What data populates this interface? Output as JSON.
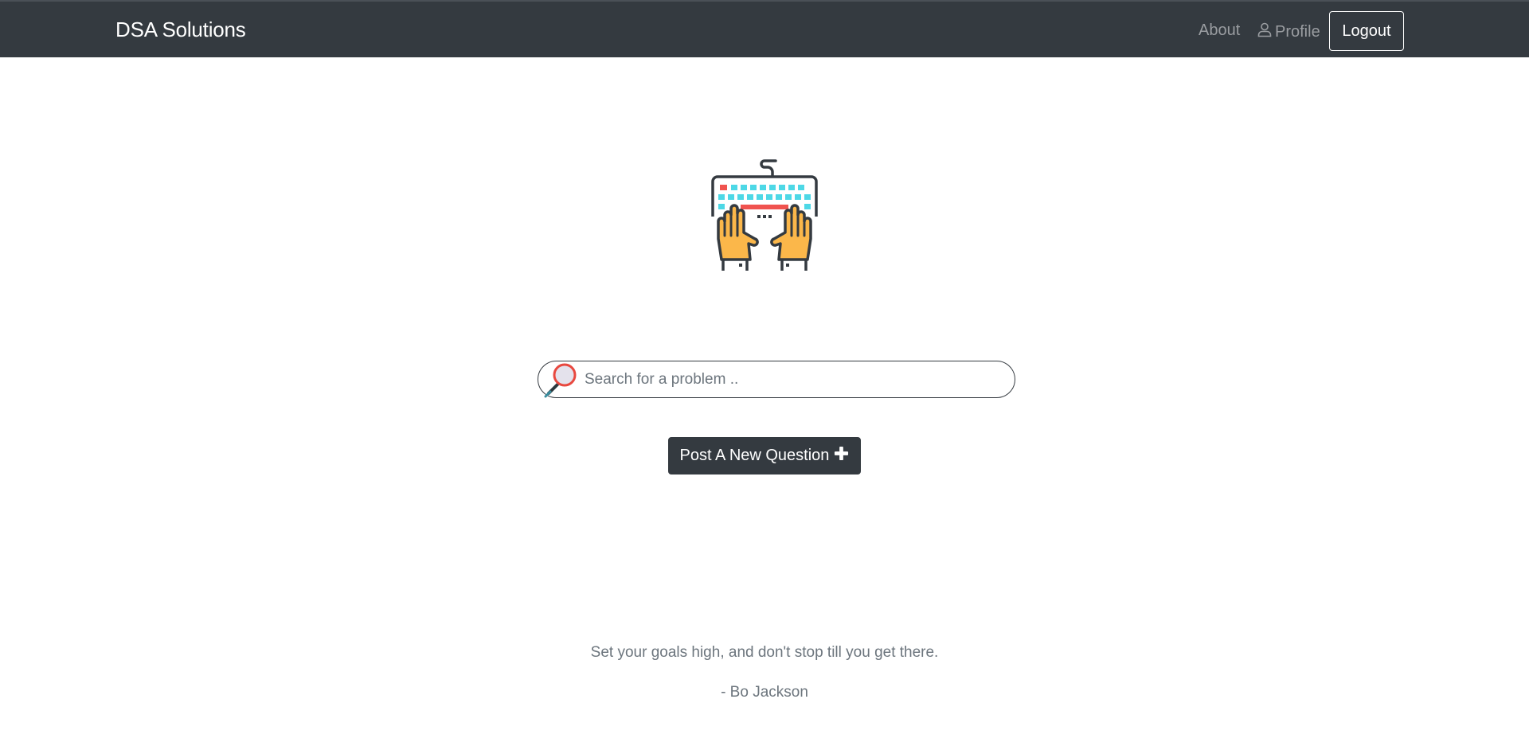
{
  "navbar": {
    "brand": "DSA Solutions",
    "about_label": "About",
    "profile_label": "Profile",
    "logout_label": "Logout"
  },
  "hero": {
    "illustration": "keyboard-hands-icon"
  },
  "search": {
    "icon": "search-icon",
    "placeholder": "Search for a problem ..",
    "value": ""
  },
  "actions": {
    "post_label": "Post A New Question",
    "post_icon": "plus-icon"
  },
  "quote": {
    "text": "Set your goals high, and don't stop till you get there.",
    "author": "- Bo Jackson"
  },
  "colors": {
    "navbar_bg": "#343a40",
    "button_bg": "#343a40",
    "muted_text": "#6c757d",
    "nav_link": "#9a9da1"
  }
}
